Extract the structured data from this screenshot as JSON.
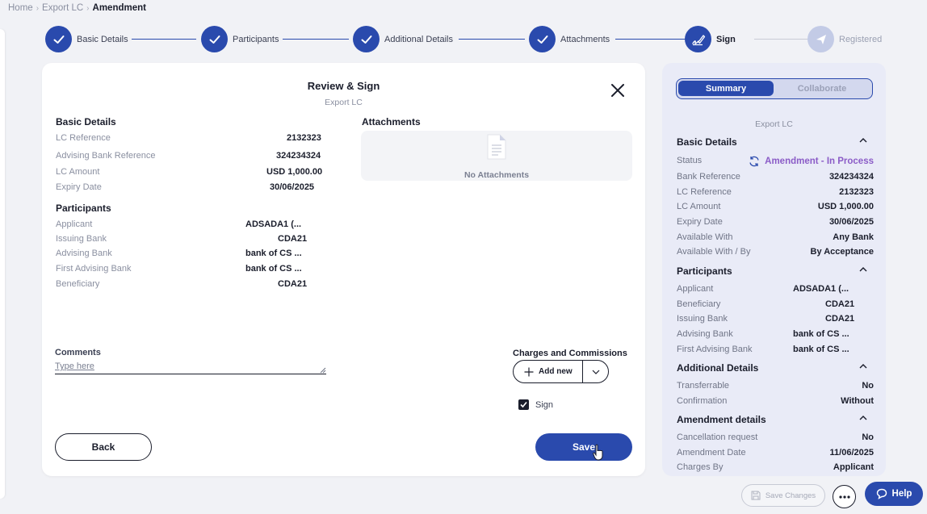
{
  "breadcrumb": {
    "home": "Home",
    "section": "Export LC",
    "current": "Amendment"
  },
  "stepper": {
    "steps": [
      {
        "label": "Basic Details",
        "state": "done"
      },
      {
        "label": "Participants",
        "state": "done"
      },
      {
        "label": "Additional Details",
        "state": "done"
      },
      {
        "label": "Attachments",
        "state": "done"
      },
      {
        "label": "Sign",
        "state": "active"
      },
      {
        "label": "Registered",
        "state": "pending"
      }
    ]
  },
  "review": {
    "title": "Review & Sign",
    "subtitle": "Export LC",
    "basic_details": {
      "heading": "Basic Details",
      "rows": [
        {
          "label": "LC Reference",
          "value": "2132323"
        },
        {
          "label": "Advising Bank Reference",
          "value": "324234324"
        },
        {
          "label": "LC Amount",
          "value": "USD 1,000.00"
        },
        {
          "label": "Expiry Date",
          "value": "30/06/2025"
        }
      ]
    },
    "participants": {
      "heading": "Participants",
      "rows": [
        {
          "label": "Applicant",
          "value": "ADSADA1 (..."
        },
        {
          "label": "Issuing Bank",
          "value": "CDA21"
        },
        {
          "label": "Advising Bank",
          "value": "bank of CS ..."
        },
        {
          "label": "First Advising Bank",
          "value": "bank of CS ..."
        },
        {
          "label": "Beneficiary",
          "value": "CDA21"
        }
      ]
    },
    "attachments": {
      "heading": "Attachments",
      "empty_text": "No Attachments"
    },
    "comments": {
      "label": "Comments",
      "placeholder": "Type here"
    },
    "charges": {
      "label": "Charges and Commissions",
      "add_new": "Add new"
    },
    "sign": {
      "label": "Sign",
      "checked": true
    },
    "back_label": "Back",
    "save_label": "Save"
  },
  "summary": {
    "tabs": {
      "active": "Summary",
      "inactive": "Collaborate"
    },
    "subtitle": "Export LC",
    "basic_details": {
      "heading": "Basic Details",
      "status_label": "Status",
      "status_value": "Amendment - In Process",
      "rows": [
        {
          "label": "Bank Reference",
          "value": "324234324"
        },
        {
          "label": "LC Reference",
          "value": "2132323"
        },
        {
          "label": "LC Amount",
          "value": "USD 1,000.00"
        },
        {
          "label": "Expiry Date",
          "value": "30/06/2025"
        },
        {
          "label": "Available With",
          "value": "Any Bank"
        },
        {
          "label": "Available With / By",
          "value": "By Acceptance"
        }
      ]
    },
    "participants": {
      "heading": "Participants",
      "rows": [
        {
          "label": "Applicant",
          "value": "ADSADA1 (..."
        },
        {
          "label": "Beneficiary",
          "value": "CDA21"
        },
        {
          "label": "Issuing Bank",
          "value": "CDA21"
        },
        {
          "label": "Advising Bank",
          "value": "bank of CS ..."
        },
        {
          "label": "First Advising Bank",
          "value": "bank of CS ..."
        }
      ]
    },
    "additional_details": {
      "heading": "Additional Details",
      "rows": [
        {
          "label": "Transferrable",
          "value": "No"
        },
        {
          "label": "Confirmation",
          "value": "Without"
        }
      ]
    },
    "amendment_details": {
      "heading": "Amendment details",
      "rows": [
        {
          "label": "Cancellation request",
          "value": "No"
        },
        {
          "label": "Amendment Date",
          "value": "11/06/2025"
        },
        {
          "label": "Charges By",
          "value": "Applicant"
        }
      ]
    }
  },
  "footer": {
    "save_changes": "Save Changes",
    "help": "Help"
  },
  "colors": {
    "primary": "#2a4aad",
    "status_purple": "#8b5cc7",
    "panel": "#e9ebf7"
  }
}
